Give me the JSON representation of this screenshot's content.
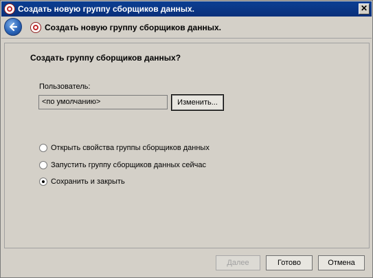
{
  "window": {
    "title": "Создать новую группу сборщиков данных.",
    "close_label": "✕"
  },
  "nav": {
    "title": "Создать новую группу сборщиков данных."
  },
  "main": {
    "heading": "Создать группу сборщиков данных?",
    "user_label": "Пользователь:",
    "user_value": "<по умолчанию>",
    "change_button": "Изменить...",
    "options": [
      {
        "label": "Открыть свойства группы сборщиков данных",
        "checked": false
      },
      {
        "label": "Запустить группу сборщиков данных сейчас",
        "checked": false
      },
      {
        "label": "Сохранить и закрыть",
        "checked": true
      }
    ]
  },
  "footer": {
    "next_label": "Далее",
    "done_label": "Готово",
    "cancel_label": "Отмена"
  },
  "colors": {
    "titlebar": "#0b3f93",
    "dialog_bg": "#d4d0c8"
  }
}
